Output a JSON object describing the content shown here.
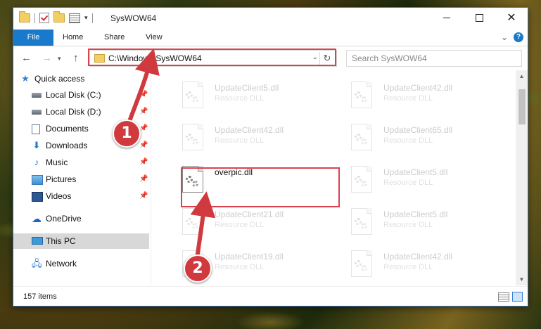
{
  "window": {
    "title": "SysWOW64",
    "controls": {
      "minimize": "",
      "maximize": "",
      "close": "✕"
    }
  },
  "ribbon": {
    "tabs": [
      "File",
      "Home",
      "Share",
      "View"
    ]
  },
  "address": {
    "path": "C:\\Windows\\SysWOW64",
    "refresh_glyph": "↻"
  },
  "search": {
    "placeholder": "Search SysWOW64"
  },
  "nav_pane": {
    "items": [
      {
        "label": "Quick access",
        "icon": "star-icon",
        "pinned": false
      },
      {
        "label": "Local Disk (C:)",
        "icon": "local-disk-icon",
        "pinned": true
      },
      {
        "label": "Local Disk (D:)",
        "icon": "local-disk-icon",
        "pinned": true
      },
      {
        "label": "Documents",
        "icon": "documents-icon",
        "pinned": true
      },
      {
        "label": "Downloads",
        "icon": "downloads-icon",
        "pinned": true
      },
      {
        "label": "Music",
        "icon": "music-icon",
        "pinned": true
      },
      {
        "label": "Pictures",
        "icon": "pictures-icon",
        "pinned": true
      },
      {
        "label": "Videos",
        "icon": "videos-icon",
        "pinned": true
      },
      {
        "label": "OneDrive",
        "icon": "onedrive-icon",
        "pinned": false
      },
      {
        "label": "This PC",
        "icon": "this-pc-icon",
        "pinned": false,
        "selected": true
      },
      {
        "label": "Network",
        "icon": "network-icon",
        "pinned": false
      }
    ]
  },
  "files": [
    {
      "name": "UpdateClient5.dll",
      "type": "Resource DLL",
      "faded": true
    },
    {
      "name": "UpdateClient42.dll",
      "type": "Resource DLL",
      "faded": true
    },
    {
      "name": "UpdateClient42.dll",
      "type": "Resource DLL",
      "faded": true
    },
    {
      "name": "UpdateClient65.dll",
      "type": "Resource DLL",
      "faded": true
    },
    {
      "name": "overpic.dll",
      "type": "",
      "faded": false
    },
    {
      "name": "UpdateClient5.dll",
      "type": "Resource DLL",
      "faded": true
    },
    {
      "name": "UpdateClient21.dll",
      "type": "Resource DLL",
      "faded": true
    },
    {
      "name": "UpdateClient5.dll",
      "type": "Resource DLL",
      "faded": true
    },
    {
      "name": "UpdateClient19.dll",
      "type": "Resource DLL",
      "faded": true
    },
    {
      "name": "UpdateClient42.dll",
      "type": "Resource DLL",
      "faded": true
    }
  ],
  "status": {
    "item_count": "157 items"
  },
  "annotations": {
    "badge_1": "1",
    "badge_2": "2",
    "color": "#d03a3f"
  }
}
